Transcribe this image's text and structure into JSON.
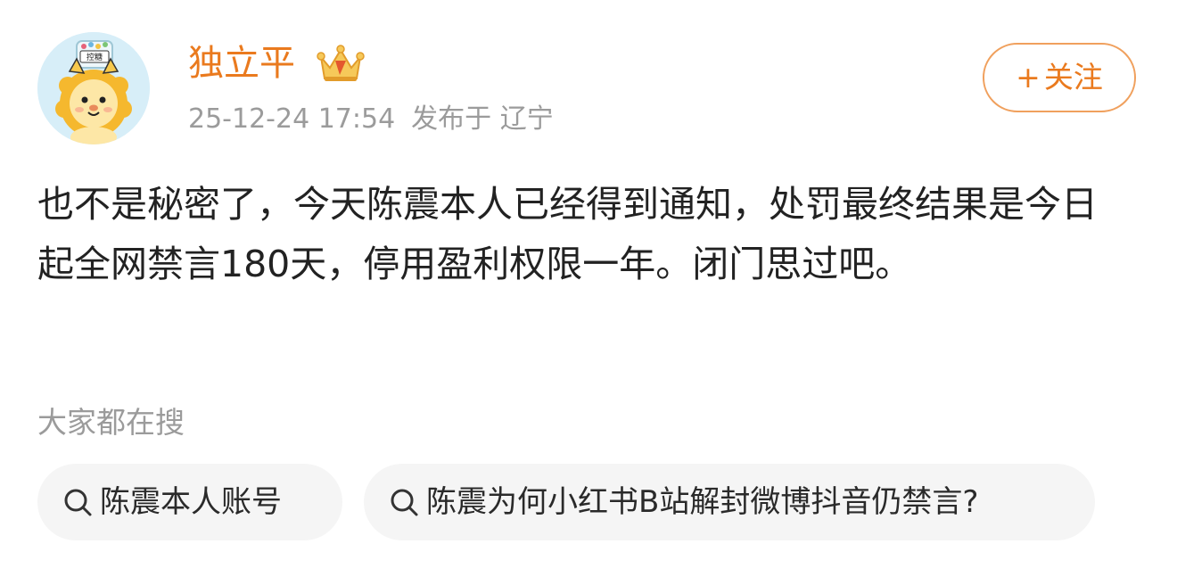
{
  "post": {
    "author": {
      "name": "独立平",
      "avatar_badge_text": "控糖",
      "badge_icon": "vip-crown-icon"
    },
    "meta": {
      "timestamp": "25-12-24 17:54",
      "location": "发布于 辽宁"
    },
    "follow_button": {
      "plus": "+",
      "label": "关注"
    },
    "content": "也不是秘密了，今天陈震本人已经得到通知，处罚最终结果是今日起全网禁言180天，停用盈利权限一年。闭门思过吧。"
  },
  "related_searches": {
    "title": "大家都在搜",
    "items": [
      {
        "label": "陈震本人账号",
        "icon": "search-icon"
      },
      {
        "label": "陈震为何小红书B站解封微博抖音仍禁言?",
        "icon": "search-icon"
      }
    ]
  },
  "colors": {
    "accent": "#ea7a1e",
    "muted_text": "#9b9b9b",
    "chip_bg": "#f5f5f5"
  }
}
